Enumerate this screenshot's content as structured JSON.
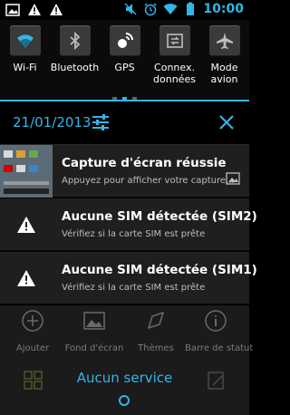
{
  "status_bar": {
    "time": "10:00",
    "left_icons": [
      "image-icon",
      "warning-icon",
      "warning-icon"
    ],
    "right_icons": [
      "mute-icon",
      "alarm-icon",
      "wifi-icon",
      "battery-icon"
    ]
  },
  "quick_settings": {
    "toggles": [
      {
        "label": "Wi-Fi",
        "icon": "wifi-icon",
        "active": true
      },
      {
        "label": "Bluetooth",
        "icon": "bluetooth-icon",
        "active": false
      },
      {
        "label": "GPS",
        "icon": "gps-icon",
        "active": true
      },
      {
        "label": "Connex.\ndonnées",
        "icon": "data-connection-icon",
        "active": false
      },
      {
        "label": "Mode\navion",
        "icon": "airplane-icon",
        "active": false
      }
    ],
    "page_count": 3,
    "current_page": 2
  },
  "header": {
    "date": "21/01/2013"
  },
  "notifications": [
    {
      "title": "Capture d'écran réussie",
      "subtitle": "Appuyez pour afficher votre capture...",
      "icon": "screenshot-thumbnail"
    },
    {
      "title": "Aucune SIM détectée (SIM2)",
      "subtitle": "Vérifiez si la carte SIM est prête",
      "icon": "warning-icon"
    },
    {
      "title": "Aucune SIM détectée (SIM1)",
      "subtitle": "Vérifiez si la carte SIM est prête",
      "icon": "warning-icon"
    }
  ],
  "background": {
    "widgets": [
      {
        "label": "Ajouter",
        "icon": "add-icon"
      },
      {
        "label": "Fond d'écran",
        "icon": "wallpaper-icon"
      },
      {
        "label": "Thèmes",
        "icon": "themes-icon"
      },
      {
        "label": "Barre de statut",
        "icon": "info-icon"
      }
    ]
  },
  "carrier": {
    "label": "Aucun service"
  },
  "colors": {
    "accent": "#33b5e5",
    "notification_bg": "#1f1f1f",
    "panel_bg": "#000000"
  }
}
